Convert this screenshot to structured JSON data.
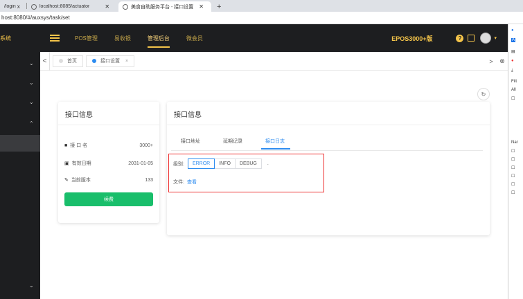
{
  "browser": {
    "tabs": [
      {
        "label": "/login",
        "close": "x"
      },
      {
        "label": "localhost:8085/actuator",
        "close": "✕"
      },
      {
        "label": "美食自助服务平台 - 接口设置",
        "close": "✕"
      }
    ],
    "new_tab": "+",
    "address": "host:8080/#/auxsys/task/set"
  },
  "topnav": {
    "brand": "系统",
    "items": [
      "POS管理",
      "易收银",
      "管理后台",
      "微会员"
    ],
    "active_index": 2,
    "account": "EPOS3000+版",
    "help": "?"
  },
  "pagetabs": {
    "prev": "<",
    "next": ">",
    "close_all": "⊗",
    "items": [
      {
        "label": "首页"
      },
      {
        "label": "接口设置",
        "close": "×"
      }
    ]
  },
  "left_card": {
    "title": "接口信息",
    "rows": [
      {
        "label": "接 口 名",
        "value": "3000+"
      },
      {
        "label": "有效日期",
        "value": "2031-01-05"
      },
      {
        "label": "当前版本",
        "value": "133"
      }
    ],
    "button": "续费"
  },
  "right_card": {
    "title": "接口信息",
    "tabs": [
      "接口地址",
      "延期记录",
      "接口日志"
    ],
    "active_tab": 2,
    "level_label": "级别:",
    "levels": [
      "ERROR",
      "INFO",
      "DEBUG"
    ],
    "active_level": 0,
    "level_suffix": ".",
    "file_label": "文件:",
    "file_link": "查看"
  },
  "devtools": {
    "labels": [
      "Filt",
      "All",
      "Nar"
    ]
  }
}
